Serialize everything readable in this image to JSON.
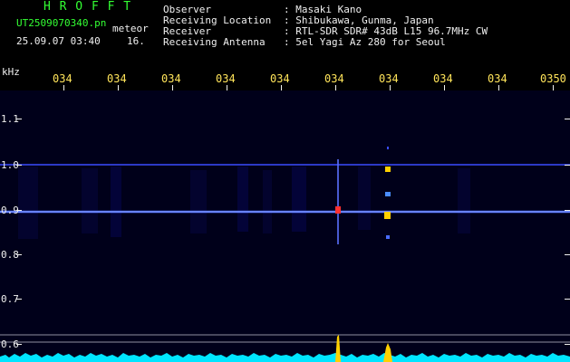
{
  "station": {
    "logo": "H R O F F T",
    "filename": "UT2509070340.pn",
    "mode": "meteor",
    "date_time": "25.09.07 03:40",
    "counter": "16."
  },
  "info": {
    "labels": [
      "Observer",
      "Receiving Location",
      "Receiver",
      "Receiving Antenna"
    ],
    "values": [
      ": Masaki Kano",
      ": Shibukawa, Gunma, Japan",
      ": RTL-SDR SDR# 43dB L15 96.7MHz CW",
      ": 5el Yagi Az 280 for Seoul"
    ]
  },
  "axis": {
    "unit": "kHz",
    "x_ticks": [
      "034",
      "034",
      "034",
      "034",
      "034",
      "034",
      "034",
      "034",
      "034",
      "0350"
    ],
    "y_ticks": [
      "1.1",
      "1.0",
      "0.9",
      "0.8",
      "0.7",
      "0.6"
    ]
  },
  "colors": {
    "background": "#000000",
    "plot_background": "#00001a",
    "logo": "#33ff33",
    "text": "#f0f0f0",
    "ticks": "#ffe45a",
    "trace": "#3040ff",
    "trace_highlight": "#ffd000",
    "spectrum": "#00e5ff"
  }
}
